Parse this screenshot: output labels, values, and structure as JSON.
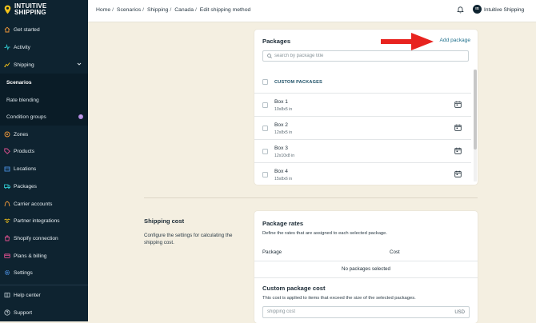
{
  "brand": {
    "line1": "INTUITIVE",
    "line2": "SHIPPING"
  },
  "breadcrumb": [
    "Home",
    "Scenarios",
    "Shipping",
    "Canada",
    "Edit shipping method"
  ],
  "account": {
    "initials": "IS",
    "name": "Intuitive Shipping"
  },
  "sidebar": {
    "items": [
      {
        "label": "Get started",
        "icon": "home-icon"
      },
      {
        "label": "Activity",
        "icon": "activity-icon"
      },
      {
        "label": "Shipping",
        "icon": "shipping-icon",
        "expanded": true
      },
      {
        "label": "Scenarios",
        "sub": true,
        "active": true
      },
      {
        "label": "Rate blending",
        "sub": true
      },
      {
        "label": "Condition groups",
        "sub": true,
        "badge": "!"
      },
      {
        "label": "Zones",
        "icon": "zones-icon"
      },
      {
        "label": "Products",
        "icon": "tag-icon"
      },
      {
        "label": "Locations",
        "icon": "building-icon"
      },
      {
        "label": "Packages",
        "icon": "truck-icon"
      },
      {
        "label": "Carrier accounts",
        "icon": "carrier-icon"
      },
      {
        "label": "Partner integrations",
        "icon": "handshake-icon"
      },
      {
        "label": "Shopify connection",
        "icon": "shopify-icon"
      },
      {
        "label": "Plans & billing",
        "icon": "billing-icon"
      },
      {
        "label": "Settings",
        "icon": "gear-icon"
      }
    ],
    "footer": [
      {
        "label": "Help center",
        "icon": "book-icon"
      },
      {
        "label": "Support",
        "icon": "help-icon"
      }
    ]
  },
  "packages": {
    "title": "Packages",
    "add_label": "Add package",
    "search_placeholder": "search by package title",
    "section_label": "CUSTOM PACKAGES",
    "items": [
      {
        "name": "Box 1",
        "dims": "10x8x5 in"
      },
      {
        "name": "Box 2",
        "dims": "12x8x5 in"
      },
      {
        "name": "Box 3",
        "dims": "12x10x8 in"
      },
      {
        "name": "Box 4",
        "dims": "15x8x6 in"
      }
    ]
  },
  "shipping_cost": {
    "title": "Shipping cost",
    "description": "Configure the settings for calculating the shipping cost."
  },
  "package_rates": {
    "title": "Package rates",
    "description": "Define the rates that are assigned to each selected package.",
    "col_package": "Package",
    "col_cost": "Cost",
    "empty_text": "No packages selected"
  },
  "custom_cost": {
    "title": "Custom package cost",
    "description": "This cost is applied to items that exceed the size of the selected packages.",
    "placeholder": "shipping cost",
    "currency": "USD"
  },
  "colors": {
    "sidebar_bg": "#0e2330",
    "page_bg": "#f4efe1",
    "link": "#1d6f8c",
    "annotation_arrow": "#e8231f"
  }
}
